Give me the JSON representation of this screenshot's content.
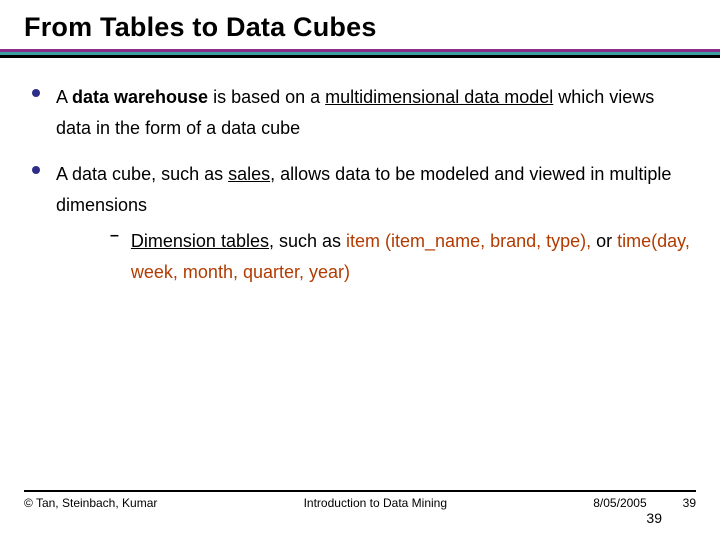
{
  "title": "From Tables to Data Cubes",
  "bullets": [
    {
      "segments": [
        {
          "t": "A ",
          "cls": ""
        },
        {
          "t": "data warehouse",
          "cls": "b"
        },
        {
          "t": " is based on a ",
          "cls": ""
        },
        {
          "t": "multidimensional data model",
          "cls": "u"
        },
        {
          "t": " which views data in the form of a data cube",
          "cls": ""
        }
      ]
    },
    {
      "segments": [
        {
          "t": "A data cube, such as ",
          "cls": ""
        },
        {
          "t": "sales",
          "cls": "u"
        },
        {
          "t": ", allows data to be modeled and viewed in multiple dimensions",
          "cls": ""
        }
      ],
      "sub": [
        {
          "segments": [
            {
              "t": "Dimension tables",
              "cls": "u"
            },
            {
              "t": ", such as ",
              "cls": ""
            },
            {
              "t": "item (item_name, brand, type),",
              "cls": "hl"
            },
            {
              "t": " or ",
              "cls": ""
            },
            {
              "t": "time(day, week, month, quarter, year)",
              "cls": "hl"
            }
          ]
        }
      ]
    }
  ],
  "footer": {
    "left": "© Tan, Steinbach, Kumar",
    "center": "Introduction to Data Mining",
    "right": "8/05/2005",
    "page": "39",
    "page2": "39"
  }
}
